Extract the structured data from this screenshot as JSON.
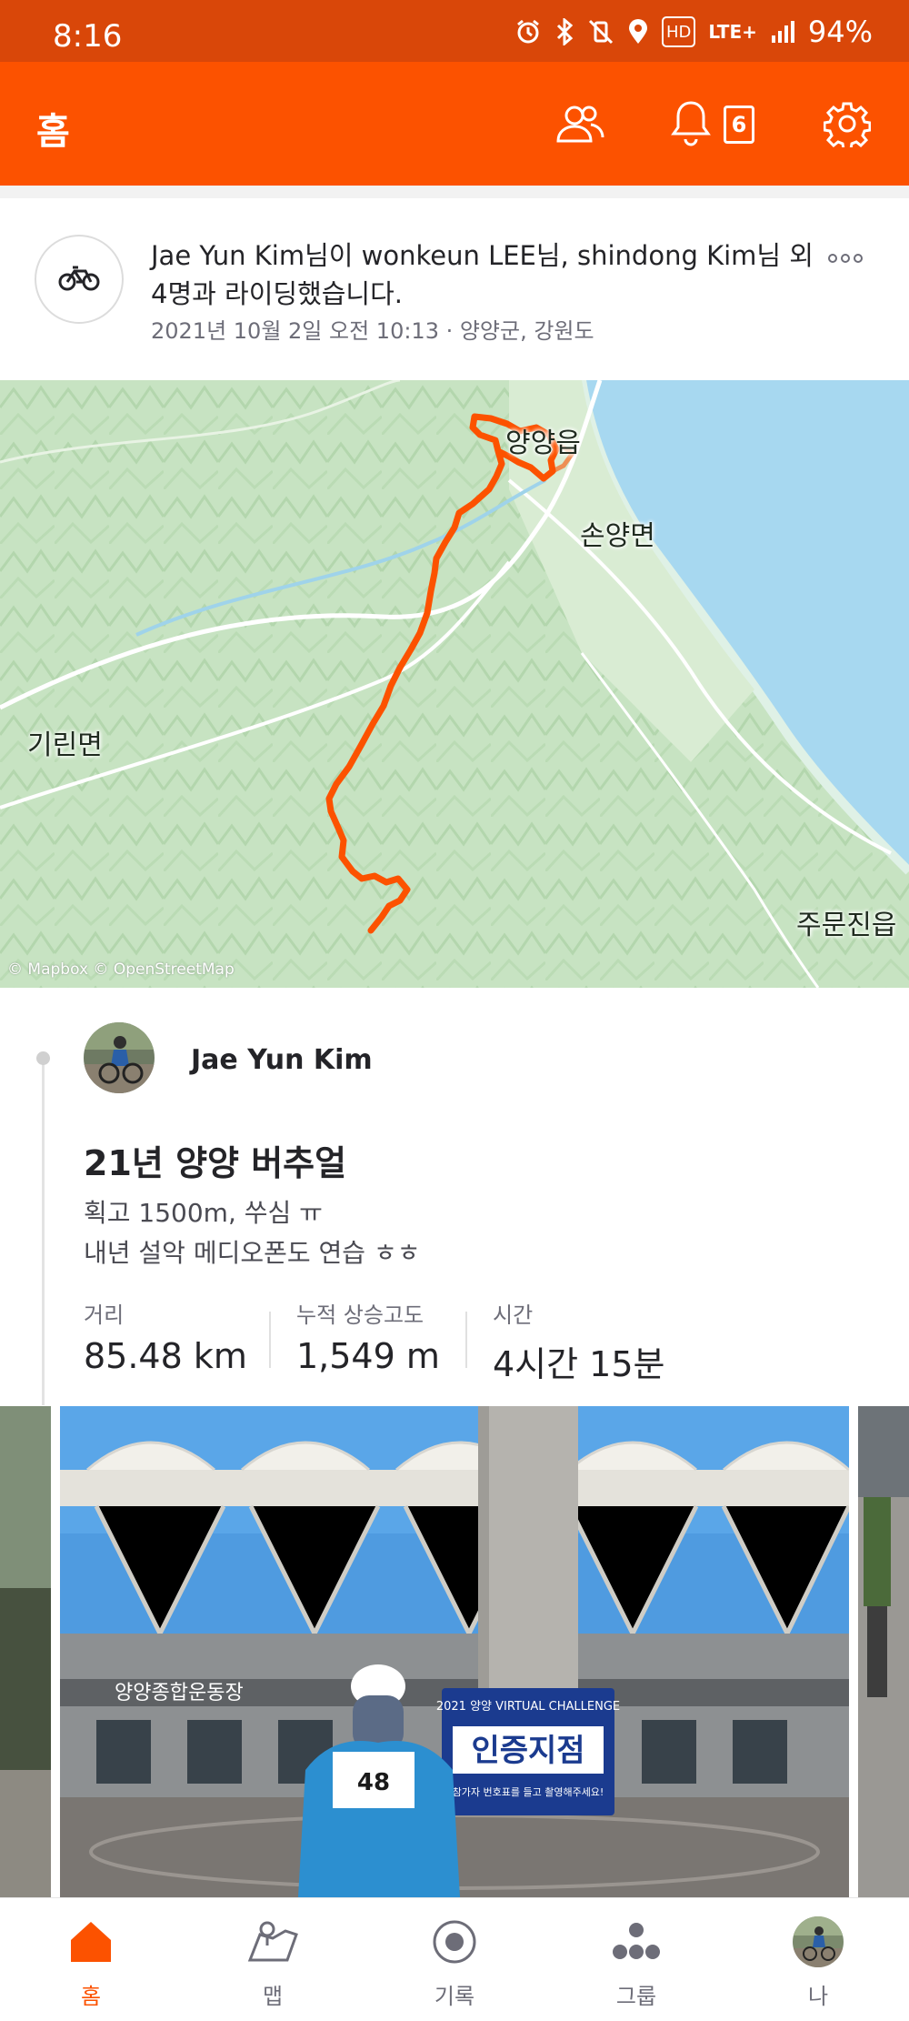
{
  "status_bar": {
    "time": "8:16",
    "network": "LTE+",
    "hd": "HD",
    "battery": "94%"
  },
  "app_bar": {
    "title": "홈",
    "notification_count": "6",
    "accent_color": "#fc5200"
  },
  "post": {
    "summary": "Jae Yun Kim님이 wonkeun LEE님, shindong Kim님 외 4명과 라이딩했습니다.",
    "meta": "2021년 10월 2일 오전 10:13 · 양양군, 강원도",
    "activity_icon": "bike-icon"
  },
  "map": {
    "labels": [
      "양양읍",
      "손양면",
      "기린면",
      "주문진읍"
    ],
    "attribution": "© Mapbox © OpenStreetMap",
    "route_color": "#fc5200"
  },
  "activity": {
    "athlete_name": "Jae Yun Kim",
    "title": "21년 양양 버추얼",
    "description": [
      "획고 1500m, 쑤심 ㅠ",
      "내년 설악 메디오폰도 연습 ㅎㅎ"
    ],
    "stats": [
      {
        "label": "거리",
        "value": "85.48 km"
      },
      {
        "label": "누적 상승고도",
        "value": "1,549 m"
      },
      {
        "label": "시간",
        "value": "4시간 15분"
      }
    ]
  },
  "photo": {
    "sign_small": "2021 양양 VIRTUAL CHALLENGE",
    "sign_main": "인증지점",
    "sign_sub": "참가자 번호표를 들고 촬영해주세요!",
    "bib": "48",
    "building_sign": "양양종합운동장"
  },
  "bottom_nav": [
    {
      "label": "홈",
      "icon": "home-icon",
      "active": true
    },
    {
      "label": "맵",
      "icon": "map-icon",
      "active": false
    },
    {
      "label": "기록",
      "icon": "record-icon",
      "active": false
    },
    {
      "label": "그룹",
      "icon": "groups-icon",
      "active": false
    },
    {
      "label": "나",
      "icon": "profile-avatar-icon",
      "active": false
    }
  ]
}
